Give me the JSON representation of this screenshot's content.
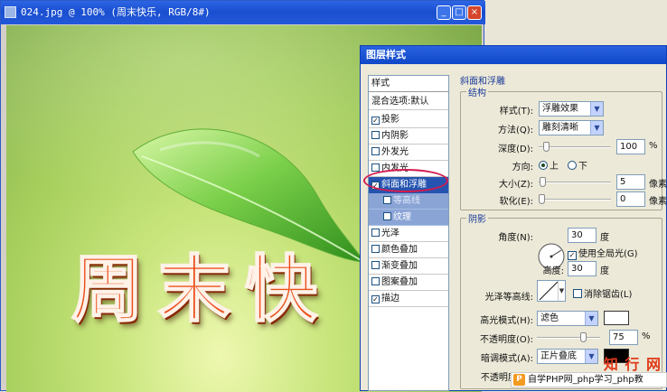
{
  "image_window": {
    "title": "024.jpg @ 100% (周末快乐, RGB/8#)",
    "buttons": {
      "minimize": "_",
      "maximize": "□",
      "close": "×"
    },
    "canvas_text": "周末快"
  },
  "dialog": {
    "title": "图层样式",
    "style_list": {
      "header": "样式",
      "blend": "混合选项:默认",
      "items": [
        {
          "label": "投影",
          "checked": true
        },
        {
          "label": "内阴影",
          "checked": false
        },
        {
          "label": "外发光",
          "checked": false
        },
        {
          "label": "内发光",
          "checked": false
        },
        {
          "label": "斜面和浮雕",
          "checked": true
        },
        {
          "label": "等高线",
          "checked": false
        },
        {
          "label": "纹理",
          "checked": false
        },
        {
          "label": "光泽",
          "checked": false
        },
        {
          "label": "颜色叠加",
          "checked": false
        },
        {
          "label": "渐变叠加",
          "checked": false
        },
        {
          "label": "图案叠加",
          "checked": false
        },
        {
          "label": "描边",
          "checked": true
        }
      ]
    },
    "bevel": {
      "section": "斜面和浮雕",
      "structure": {
        "title": "结构",
        "style_label": "样式(T):",
        "style_value": "浮雕效果",
        "technique_label": "方法(Q):",
        "technique_value": "雕刻清晰",
        "depth_label": "深度(D):",
        "depth_value": "100",
        "depth_unit": "%",
        "direction_label": "方向:",
        "direction_up": "上",
        "direction_down": "下",
        "size_label": "大小(Z):",
        "size_value": "5",
        "size_unit": "像素",
        "soften_label": "软化(E):",
        "soften_value": "0",
        "soften_unit": "像素"
      },
      "shading": {
        "title": "阴影",
        "angle_label": "角度(N):",
        "angle_value": "30",
        "angle_unit": "度",
        "global_light": "使用全局光(G)",
        "altitude_label": "高度:",
        "altitude_value": "30",
        "altitude_unit": "度",
        "gloss_label": "光泽等高线:",
        "antialias": "消除锯齿(L)",
        "highlight_label": "高光模式(H):",
        "highlight_value": "滤色",
        "highlight_color": "#ffffff",
        "highlight_opacity_label": "不透明度(O):",
        "highlight_opacity_value": "75",
        "highlight_opacity_unit": "%",
        "shadow_label": "暗调模式(A):",
        "shadow_value": "正片叠底",
        "shadow_color": "#000000",
        "shadow_opacity_label": "不透明度(C):"
      }
    }
  },
  "watermark": {
    "brand": "知 行 网",
    "bar_icon": "P",
    "bar_text": "自学PHP网_php学习_php教"
  }
}
